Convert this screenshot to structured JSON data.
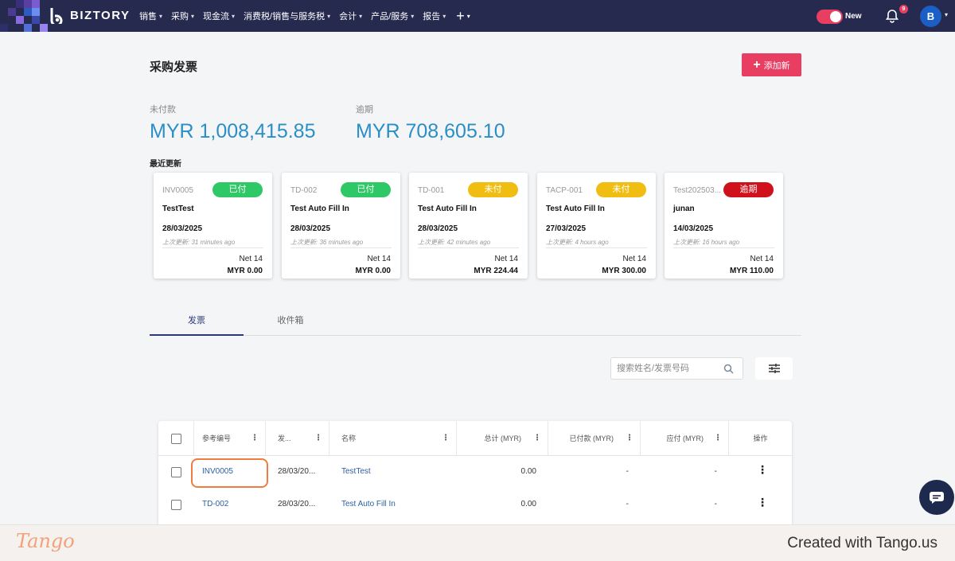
{
  "nav": {
    "brand": "BIZTORY",
    "menu": [
      {
        "label": "销售"
      },
      {
        "label": "采购"
      },
      {
        "label": "现金流"
      },
      {
        "label": "消费税/销售与服务税"
      },
      {
        "label": "会计"
      },
      {
        "label": "产品/服务"
      },
      {
        "label": "报告"
      }
    ],
    "plus": "+",
    "toggle_label": "New",
    "notification_count": "9",
    "avatar_initial": "B"
  },
  "page": {
    "title": "采购发票",
    "add_button": "添加新",
    "unpaid_label": "未付款",
    "unpaid_value": "MYR 1,008,415.85",
    "overdue_label": "逾期",
    "overdue_value": "MYR 708,605.10",
    "recent_label": "最近更新"
  },
  "cards": [
    {
      "ref": "INV0005",
      "status": "已付",
      "status_color": "#2ec866",
      "name": "TestTest",
      "date": "28/03/2025",
      "updated": "上次更新: 31 minutes ago",
      "term": "Net 14",
      "amount": "MYR 0.00"
    },
    {
      "ref": "TD-002",
      "status": "已付",
      "status_color": "#2ec866",
      "name": "Test Auto Fill In",
      "date": "28/03/2025",
      "updated": "上次更新: 36 minutes ago",
      "term": "Net 14",
      "amount": "MYR 0.00"
    },
    {
      "ref": "TD-001",
      "status": "未付",
      "status_color": "#f0be13",
      "name": "Test Auto Fill In",
      "date": "28/03/2025",
      "updated": "上次更新: 42 minutes ago",
      "term": "Net 14",
      "amount": "MYR 224.44"
    },
    {
      "ref": "TACP-001",
      "status": "未付",
      "status_color": "#f0be13",
      "name": "Test Auto Fill In",
      "date": "27/03/2025",
      "updated": "上次更新: 4 hours ago",
      "term": "Net 14",
      "amount": "MYR 300.00"
    },
    {
      "ref": "Test202503...",
      "status": "逾期",
      "status_color": "#d0111b",
      "name": "junan",
      "date": "14/03/2025",
      "updated": "上次更新: 16 hours ago",
      "term": "Net 14",
      "amount": "MYR 110.00"
    }
  ],
  "tabs": [
    {
      "label": "发票",
      "active": true
    },
    {
      "label": "收件箱",
      "active": false
    }
  ],
  "search": {
    "placeholder": "搜索姓名/发票号码"
  },
  "table": {
    "headers": [
      "参考编号",
      "发...",
      "名称",
      "总计 (MYR)",
      "已付款 (MYR)",
      "应付 (MYR)",
      "操作"
    ],
    "rows": [
      {
        "ref": "INV0005",
        "date": "28/03/20...",
        "name": "TestTest",
        "total": "0.00",
        "paid": "-",
        "due": "-"
      },
      {
        "ref": "TD-002",
        "date": "28/03/20...",
        "name": "Test Auto Fill In",
        "total": "0.00",
        "paid": "-",
        "due": "-"
      }
    ]
  },
  "footer": {
    "logo": "Tango",
    "credit": "Created with Tango.us"
  }
}
